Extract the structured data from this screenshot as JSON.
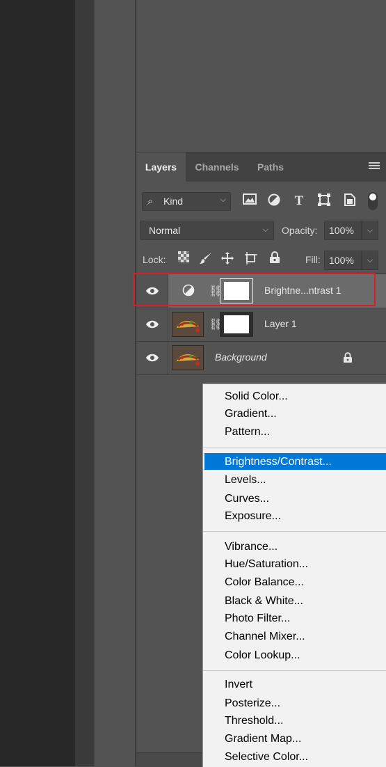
{
  "layers_panel": {
    "tabs": [
      {
        "label": "Layers",
        "active": true
      },
      {
        "label": "Channels",
        "active": false
      },
      {
        "label": "Paths",
        "active": false
      }
    ],
    "filter": {
      "kind_label": "Kind",
      "icons": [
        "image-filter-icon",
        "adjustment-filter-icon",
        "type-filter-icon",
        "shape-filter-icon",
        "smart-object-filter-icon"
      ]
    },
    "blend_mode": "Normal",
    "opacity_label": "Opacity:",
    "opacity_value": "100%",
    "lock_label": "Lock:",
    "fill_label": "Fill:",
    "fill_value": "100%",
    "layers": [
      {
        "name": "Brightne...ntrast 1",
        "type": "adjustment",
        "selected": true
      },
      {
        "name": "Layer 1",
        "type": "image-with-mask",
        "selected": false
      },
      {
        "name": "Background",
        "type": "background",
        "locked": true
      }
    ]
  },
  "adjustment_menu": {
    "groups": [
      [
        "Solid Color...",
        "Gradient...",
        "Pattern..."
      ],
      [
        "Brightness/Contrast...",
        "Levels...",
        "Curves...",
        "Exposure..."
      ],
      [
        "Vibrance...",
        "Hue/Saturation...",
        "Color Balance...",
        "Black & White...",
        "Photo Filter...",
        "Channel Mixer...",
        "Color Lookup..."
      ],
      [
        "Invert",
        "Posterize...",
        "Threshold...",
        "Gradient Map...",
        "Selective Color..."
      ]
    ],
    "highlighted": "Brightness/Contrast..."
  },
  "colors": {
    "highlight_border": "#d3202a",
    "menu_selection": "#0078d7",
    "panel_bg": "#535353"
  }
}
